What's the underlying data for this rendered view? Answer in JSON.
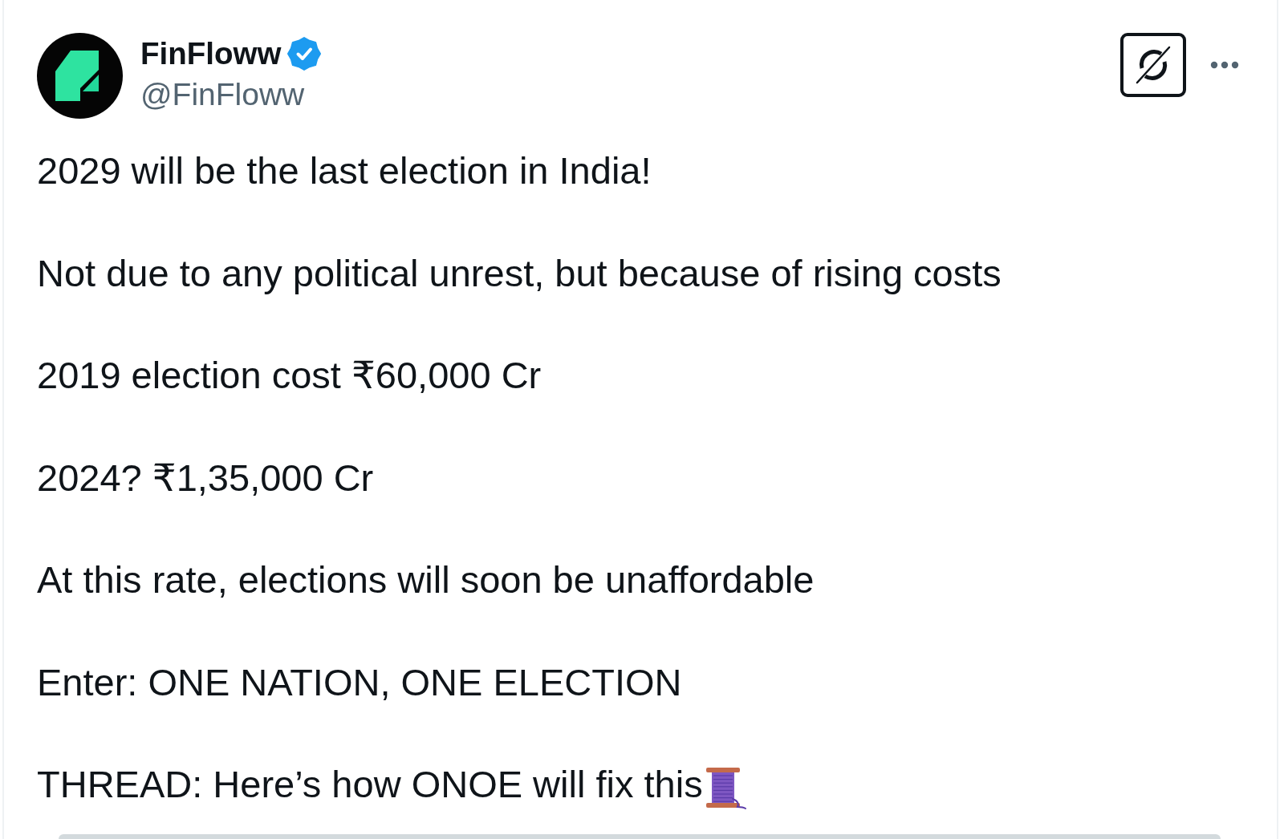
{
  "post": {
    "author": {
      "name": "FinFloww",
      "verified": true,
      "handle": "@FinFloww"
    },
    "paragraphs": [
      {
        "text": "2029 will be the last election in India!"
      },
      {
        "text": "Not due to any political unrest, but because of rising costs"
      },
      {
        "text": "2019 election cost ₹60,000 Cr"
      },
      {
        "text": "2024? ₹1,35,000 Cr"
      },
      {
        "text": "At this rate, elections will soon be unaffordable"
      },
      {
        "text": "Enter: ONE NATION, ONE ELECTION"
      },
      {
        "text": "THREAD: Here’s how ONOE will fix this",
        "kind": "thread"
      }
    ]
  }
}
